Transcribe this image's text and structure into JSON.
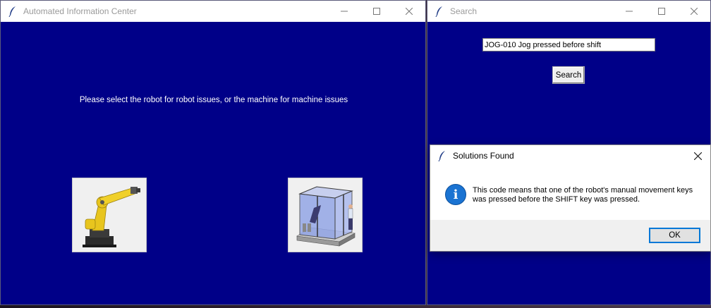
{
  "main_window": {
    "title": "Automated Information Center",
    "prompt": "Please select the robot for robot issues, or the machine for machine issues",
    "robot_button_icon": "industrial-robot-arm-image",
    "machine_button_icon": "machine-enclosure-image"
  },
  "search_window": {
    "title": "Search",
    "query_value": "JOG-010 Jog pressed before shift",
    "search_label": "Search"
  },
  "dialog": {
    "title": "Solutions Found",
    "message": "This code means that one of the robot's manual movement keys was pressed before the SHIFT key was pressed.",
    "ok_label": "OK",
    "icon": "info-icon"
  },
  "colors": {
    "client_background": "#000088",
    "accent": "#0078d7",
    "info_icon": "#1a73d2"
  }
}
